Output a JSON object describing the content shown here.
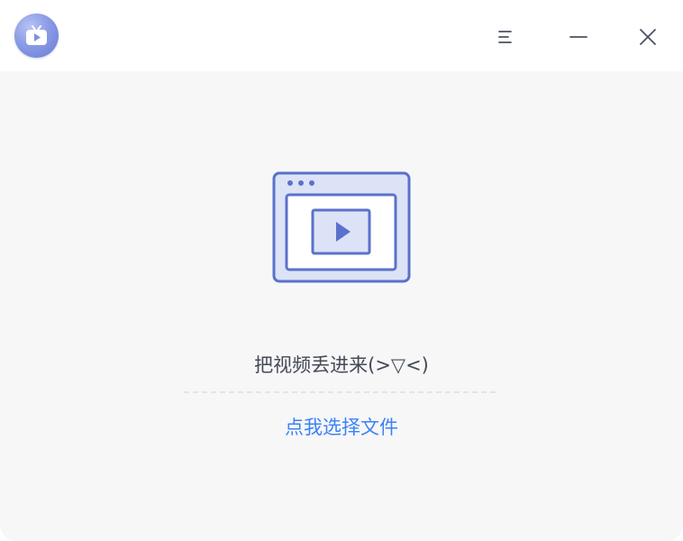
{
  "app": {
    "logo_icon": "tv-play-icon",
    "accent_color": "#5a72cc",
    "link_color": "#3b82f6"
  },
  "titlebar": {
    "menu_icon": "menu-icon",
    "minimize_icon": "minimize-icon",
    "close_icon": "close-icon"
  },
  "main": {
    "illustration_icon": "video-window-icon",
    "drop_hint": "把视频丢进来(>▽<)",
    "select_file_link": "点我选择文件"
  }
}
